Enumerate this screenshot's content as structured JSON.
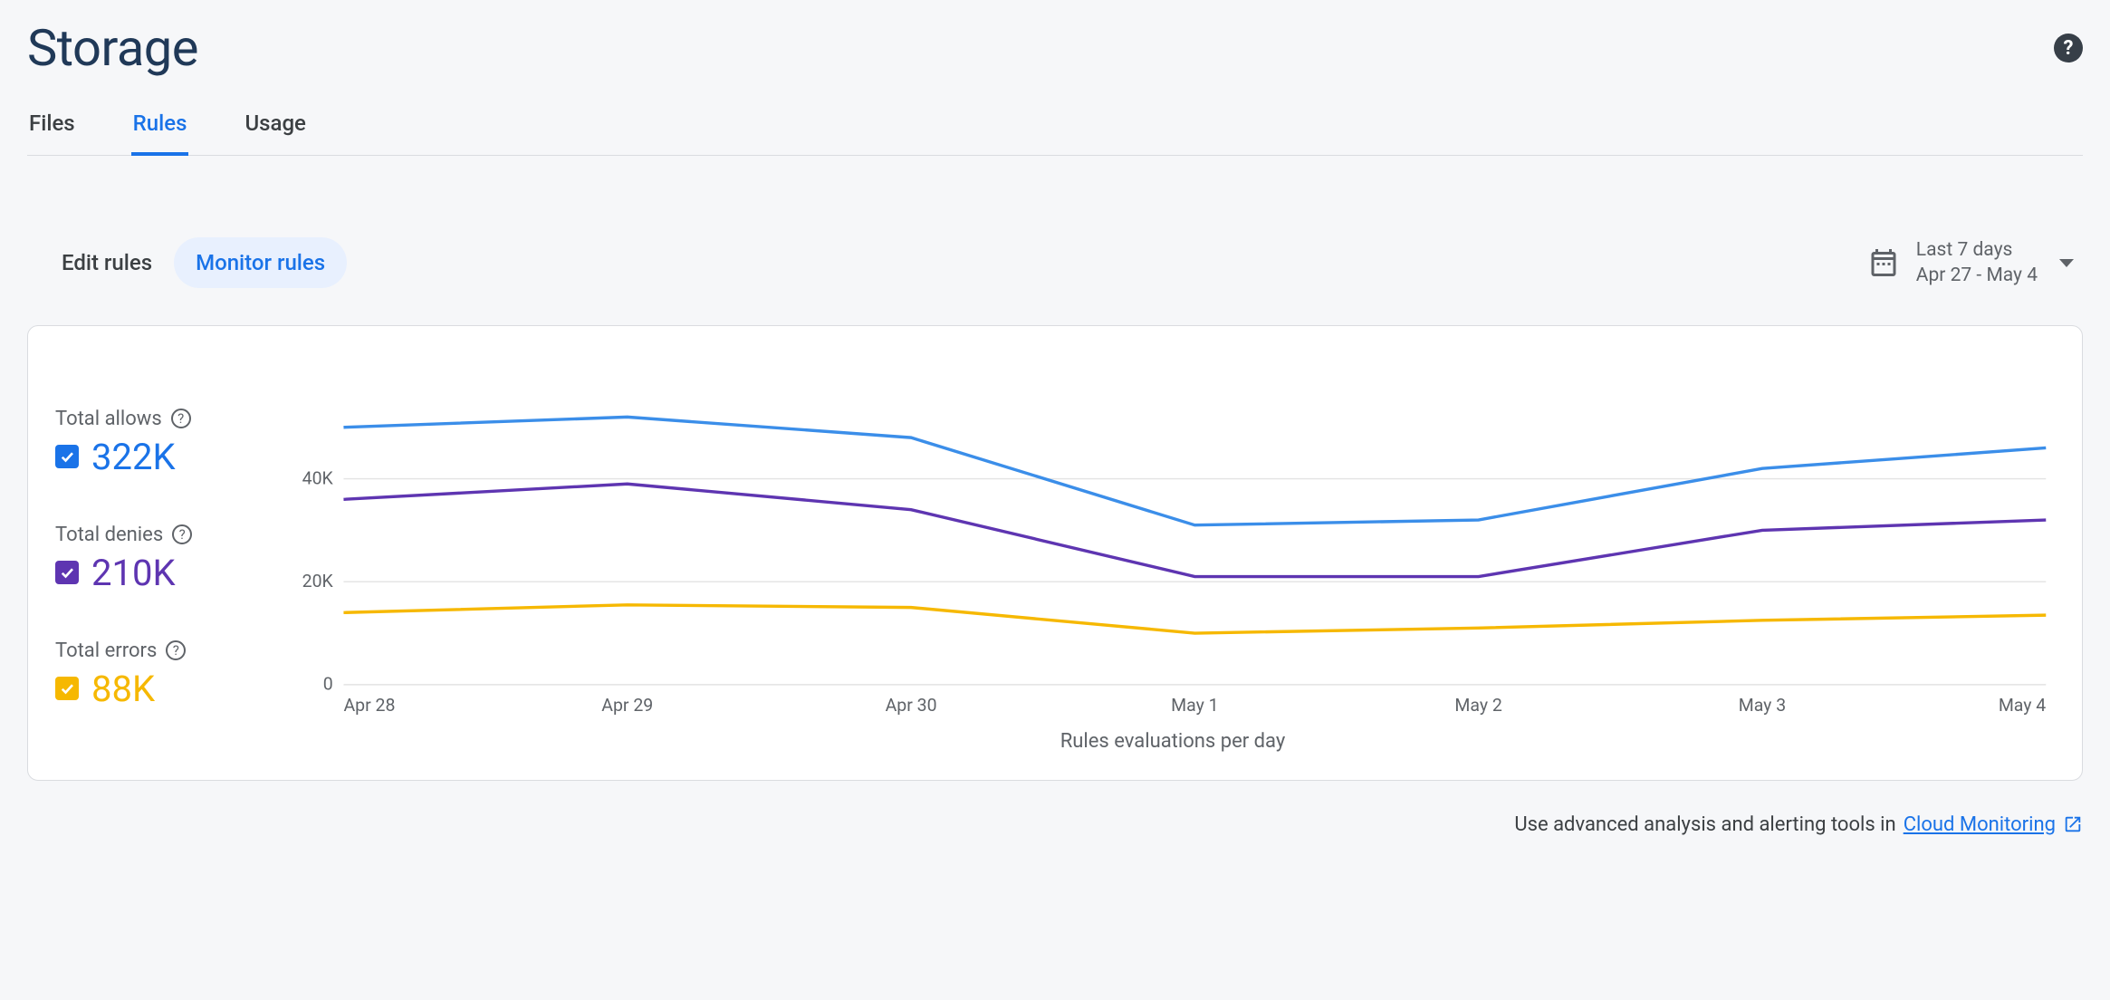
{
  "page_title": "Storage",
  "tabs": [
    {
      "label": "Files",
      "active": false
    },
    {
      "label": "Rules",
      "active": true
    },
    {
      "label": "Usage",
      "active": false
    }
  ],
  "segmented": [
    {
      "label": "Edit rules",
      "active": false
    },
    {
      "label": "Monitor rules",
      "active": true
    }
  ],
  "date_picker": {
    "range_label": "Last 7 days",
    "range_dates": "Apr 27 - May 4"
  },
  "metrics": {
    "allows": {
      "label": "Total allows",
      "value": "322K",
      "color": "#1a73e8"
    },
    "denies": {
      "label": "Total denies",
      "value": "210K",
      "color": "#5e35b1"
    },
    "errors": {
      "label": "Total errors",
      "value": "88K",
      "color": "#f6b800"
    }
  },
  "chart_caption": "Rules evaluations per day",
  "footer": {
    "text": "Use advanced analysis and alerting tools in ",
    "link_label": "Cloud Monitoring"
  },
  "chart_data": {
    "type": "line",
    "title": "Rules evaluations per day",
    "xlabel": "",
    "ylabel": "",
    "ylim": [
      0,
      60000
    ],
    "grid": true,
    "categories": [
      "Apr 28",
      "Apr 29",
      "Apr 30",
      "May 1",
      "May 2",
      "May 3",
      "May 4"
    ],
    "y_ticks": [
      0,
      20000,
      40000
    ],
    "y_tick_labels": [
      "0",
      "20K",
      "40K"
    ],
    "series": [
      {
        "name": "Total allows",
        "color": "#3b8ee9",
        "values": [
          50000,
          52000,
          48000,
          31000,
          32000,
          42000,
          46000
        ]
      },
      {
        "name": "Total denies",
        "color": "#5e35b1",
        "values": [
          36000,
          39000,
          34000,
          21000,
          21000,
          30000,
          32000
        ]
      },
      {
        "name": "Total errors",
        "color": "#f6b800",
        "values": [
          14000,
          15500,
          15000,
          10000,
          11000,
          12500,
          13500
        ]
      }
    ]
  }
}
